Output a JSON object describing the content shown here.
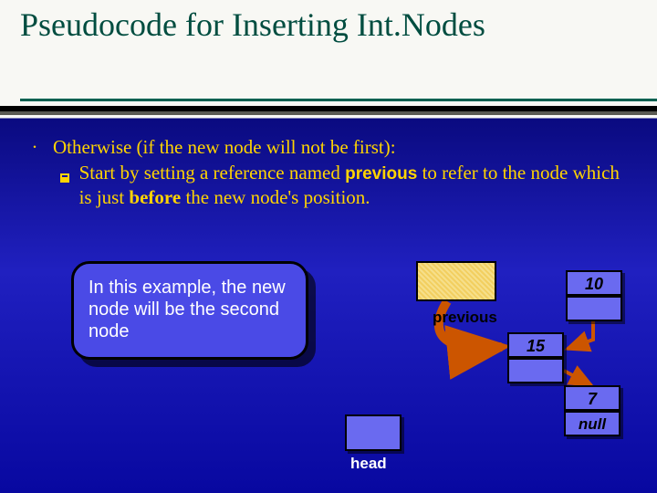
{
  "title": "Pseudocode for Inserting Int.Nodes",
  "bullets": {
    "main": "Otherwise (if the new node will not be first):",
    "sub_before": "Start by setting a reference named ",
    "sub_prev": "previous",
    "sub_mid": " to refer to the node which is just ",
    "sub_bold": "before",
    "sub_after": " the new node's position."
  },
  "example_box": "In this example, the new node will be the second node",
  "diagram": {
    "previous_label": "previous",
    "head_label": "head",
    "node10": "10",
    "node15": "15",
    "node7": "7",
    "null_label": "null"
  },
  "colors": {
    "title": "#004d40",
    "bullet_text": "#ffd400",
    "node_fill": "#6a6af0",
    "arrow": "#cc5500"
  }
}
